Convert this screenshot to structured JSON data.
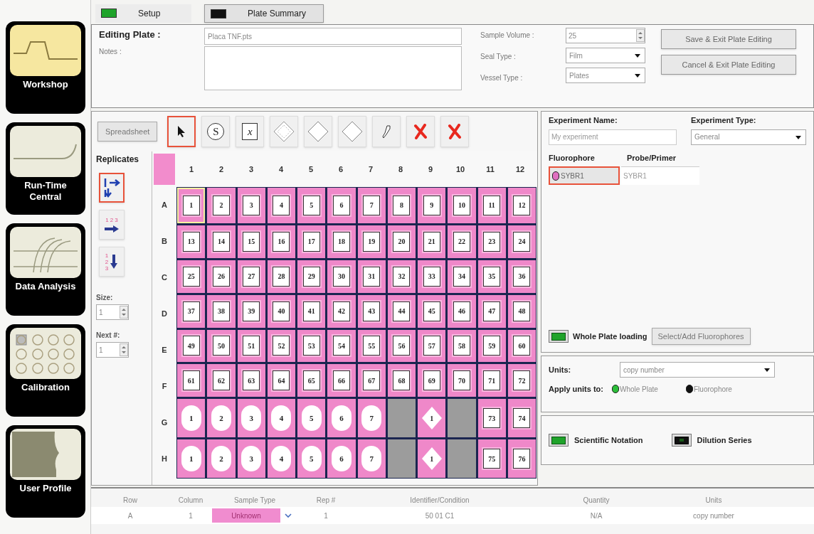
{
  "tabs": [
    {
      "label": "Setup",
      "selected": true,
      "on": true
    },
    {
      "label": "Plate Summary",
      "selected": false,
      "on": false
    }
  ],
  "nav": [
    {
      "label": "Workshop",
      "kind": "wave",
      "selected": true
    },
    {
      "label": "Run-Time Central",
      "kind": "curve",
      "selected": false
    },
    {
      "label": "Data Analysis",
      "kind": "curves",
      "selected": false
    },
    {
      "label": "Calibration",
      "kind": "wells",
      "selected": false
    },
    {
      "label": "User Profile",
      "kind": "user",
      "selected": false
    }
  ],
  "editing": {
    "title": "Editing Plate :",
    "file": "Placa TNF.pts",
    "notes_label": "Notes :",
    "sample_volume_label": "Sample Volume :",
    "sample_volume": "25",
    "seal_type_label": "Seal Type :",
    "seal_type": "Film",
    "vessel_type_label": "Vessel Type :",
    "vessel_type": "Plates",
    "buttons": [
      "Save & Exit Plate Editing",
      "Cancel & Exit Plate Editing"
    ]
  },
  "toolbar": {
    "spreadsheet": "Spreadsheet",
    "tools": [
      {
        "kind": "pointer",
        "selected": true
      },
      {
        "kind": "standard",
        "label": "S",
        "selected": false
      },
      {
        "kind": "unknown",
        "label": "x",
        "selected": false
      },
      {
        "kind": "ntc",
        "selected": false
      },
      {
        "kind": "diamond",
        "selected": false
      },
      {
        "kind": "diamond",
        "selected": false
      },
      {
        "kind": "pipette",
        "selected": false
      },
      {
        "kind": "clear",
        "selected": false
      },
      {
        "kind": "clear",
        "selected": false
      }
    ]
  },
  "replicates": {
    "title": "Replicates",
    "modes": [
      {
        "kind": "block",
        "selected": true
      },
      {
        "kind": "across",
        "digits": [
          "1",
          "2",
          "3"
        ],
        "selected": false
      },
      {
        "kind": "down",
        "digits": [
          "1",
          "2",
          "3"
        ],
        "selected": false
      }
    ],
    "size_label": "Size:",
    "size": "1",
    "next_label": "Next #:",
    "next": "1"
  },
  "plate": {
    "columns": [
      "1",
      "2",
      "3",
      "4",
      "5",
      "6",
      "7",
      "8",
      "9",
      "10",
      "11",
      "12"
    ],
    "rows": [
      {
        "label": "A",
        "wells": [
          {
            "kind": "unknown",
            "label": "1",
            "selected": true
          },
          {
            "kind": "unknown",
            "label": "2",
            "selected": false
          },
          {
            "kind": "unknown",
            "label": "3",
            "selected": false
          },
          {
            "kind": "unknown",
            "label": "4",
            "selected": false
          },
          {
            "kind": "unknown",
            "label": "5",
            "selected": false
          },
          {
            "kind": "unknown",
            "label": "6",
            "selected": false
          },
          {
            "kind": "unknown",
            "label": "7",
            "selected": false
          },
          {
            "kind": "unknown",
            "label": "8",
            "selected": false
          },
          {
            "kind": "unknown",
            "label": "9",
            "selected": false
          },
          {
            "kind": "unknown",
            "label": "10",
            "selected": false
          },
          {
            "kind": "unknown",
            "label": "11",
            "selected": false
          },
          {
            "kind": "unknown",
            "label": "12",
            "selected": false
          }
        ]
      },
      {
        "label": "B",
        "wells": [
          {
            "kind": "unknown",
            "label": "13",
            "selected": false
          },
          {
            "kind": "unknown",
            "label": "14",
            "selected": false
          },
          {
            "kind": "unknown",
            "label": "15",
            "selected": false
          },
          {
            "kind": "unknown",
            "label": "16",
            "selected": false
          },
          {
            "kind": "unknown",
            "label": "17",
            "selected": false
          },
          {
            "kind": "unknown",
            "label": "18",
            "selected": false
          },
          {
            "kind": "unknown",
            "label": "19",
            "selected": false
          },
          {
            "kind": "unknown",
            "label": "20",
            "selected": false
          },
          {
            "kind": "unknown",
            "label": "21",
            "selected": false
          },
          {
            "kind": "unknown",
            "label": "22",
            "selected": false
          },
          {
            "kind": "unknown",
            "label": "23",
            "selected": false
          },
          {
            "kind": "unknown",
            "label": "24",
            "selected": false
          }
        ]
      },
      {
        "label": "C",
        "wells": [
          {
            "kind": "unknown",
            "label": "25",
            "selected": false
          },
          {
            "kind": "unknown",
            "label": "26",
            "selected": false
          },
          {
            "kind": "unknown",
            "label": "27",
            "selected": false
          },
          {
            "kind": "unknown",
            "label": "28",
            "selected": false
          },
          {
            "kind": "unknown",
            "label": "29",
            "selected": false
          },
          {
            "kind": "unknown",
            "label": "30",
            "selected": false
          },
          {
            "kind": "unknown",
            "label": "31",
            "selected": false
          },
          {
            "kind": "unknown",
            "label": "32",
            "selected": false
          },
          {
            "kind": "unknown",
            "label": "33",
            "selected": false
          },
          {
            "kind": "unknown",
            "label": "34",
            "selected": false
          },
          {
            "kind": "unknown",
            "label": "35",
            "selected": false
          },
          {
            "kind": "unknown",
            "label": "36",
            "selected": false
          }
        ]
      },
      {
        "label": "D",
        "wells": [
          {
            "kind": "unknown",
            "label": "37",
            "selected": false
          },
          {
            "kind": "unknown",
            "label": "38",
            "selected": false
          },
          {
            "kind": "unknown",
            "label": "39",
            "selected": false
          },
          {
            "kind": "unknown",
            "label": "40",
            "selected": false
          },
          {
            "kind": "unknown",
            "label": "41",
            "selected": false
          },
          {
            "kind": "unknown",
            "label": "42",
            "selected": false
          },
          {
            "kind": "unknown",
            "label": "43",
            "selected": false
          },
          {
            "kind": "unknown",
            "label": "44",
            "selected": false
          },
          {
            "kind": "unknown",
            "label": "45",
            "selected": false
          },
          {
            "kind": "unknown",
            "label": "46",
            "selected": false
          },
          {
            "kind": "unknown",
            "label": "47",
            "selected": false
          },
          {
            "kind": "unknown",
            "label": "48",
            "selected": false
          }
        ]
      },
      {
        "label": "E",
        "wells": [
          {
            "kind": "unknown",
            "label": "49",
            "selected": false
          },
          {
            "kind": "unknown",
            "label": "50",
            "selected": false
          },
          {
            "kind": "unknown",
            "label": "51",
            "selected": false
          },
          {
            "kind": "unknown",
            "label": "52",
            "selected": false
          },
          {
            "kind": "unknown",
            "label": "53",
            "selected": false
          },
          {
            "kind": "unknown",
            "label": "54",
            "selected": false
          },
          {
            "kind": "unknown",
            "label": "55",
            "selected": false
          },
          {
            "kind": "unknown",
            "label": "56",
            "selected": false
          },
          {
            "kind": "unknown",
            "label": "57",
            "selected": false
          },
          {
            "kind": "unknown",
            "label": "58",
            "selected": false
          },
          {
            "kind": "unknown",
            "label": "59",
            "selected": false
          },
          {
            "kind": "unknown",
            "label": "60",
            "selected": false
          }
        ]
      },
      {
        "label": "F",
        "wells": [
          {
            "kind": "unknown",
            "label": "61",
            "selected": false
          },
          {
            "kind": "unknown",
            "label": "62",
            "selected": false
          },
          {
            "kind": "unknown",
            "label": "63",
            "selected": false
          },
          {
            "kind": "unknown",
            "label": "64",
            "selected": false
          },
          {
            "kind": "unknown",
            "label": "65",
            "selected": false
          },
          {
            "kind": "unknown",
            "label": "66",
            "selected": false
          },
          {
            "kind": "unknown",
            "label": "67",
            "selected": false
          },
          {
            "kind": "unknown",
            "label": "68",
            "selected": false
          },
          {
            "kind": "unknown",
            "label": "69",
            "selected": false
          },
          {
            "kind": "unknown",
            "label": "70",
            "selected": false
          },
          {
            "kind": "unknown",
            "label": "71",
            "selected": false
          },
          {
            "kind": "unknown",
            "label": "72",
            "selected": false
          }
        ]
      },
      {
        "label": "G",
        "wells": [
          {
            "kind": "standard",
            "label": "1",
            "selected": false
          },
          {
            "kind": "standard",
            "label": "2",
            "selected": false
          },
          {
            "kind": "standard",
            "label": "3",
            "selected": false
          },
          {
            "kind": "standard",
            "label": "4",
            "selected": false
          },
          {
            "kind": "standard",
            "label": "5",
            "selected": false
          },
          {
            "kind": "standard",
            "label": "6",
            "selected": false
          },
          {
            "kind": "standard",
            "label": "7",
            "selected": false
          },
          {
            "kind": "empty",
            "selected": false
          },
          {
            "kind": "ntc",
            "label": "1",
            "selected": false
          },
          {
            "kind": "empty",
            "selected": false
          },
          {
            "kind": "unknown",
            "label": "73",
            "selected": false
          },
          {
            "kind": "unknown",
            "label": "74",
            "selected": false
          }
        ]
      },
      {
        "label": "H",
        "wells": [
          {
            "kind": "standard",
            "label": "1",
            "selected": false
          },
          {
            "kind": "standard",
            "label": "2",
            "selected": false
          },
          {
            "kind": "standard",
            "label": "3",
            "selected": false
          },
          {
            "kind": "standard",
            "label": "4",
            "selected": false
          },
          {
            "kind": "standard",
            "label": "5",
            "selected": false
          },
          {
            "kind": "standard",
            "label": "6",
            "selected": false
          },
          {
            "kind": "standard",
            "label": "7",
            "selected": false
          },
          {
            "kind": "empty",
            "selected": false
          },
          {
            "kind": "ntc",
            "label": "1",
            "selected": false
          },
          {
            "kind": "empty",
            "selected": false
          },
          {
            "kind": "unknown",
            "label": "75",
            "selected": false
          },
          {
            "kind": "unknown",
            "label": "76",
            "selected": false
          }
        ]
      }
    ]
  },
  "experiment": {
    "name_label": "Experiment Name:",
    "name": "My experiment",
    "type_label": "Experiment Type:",
    "type": "General",
    "fluor_columns": [
      "Fluorophore",
      "Probe/Primer"
    ],
    "fluorophores": [
      {
        "name": "SYBR1",
        "probe": "SYBR1",
        "color": "#e070c0",
        "selected": true
      }
    ],
    "whole_plate": {
      "label": "Whole Plate loading",
      "on": true
    },
    "select_button": "Select/Add Fluorophores"
  },
  "units": {
    "label": "Units:",
    "value": "copy number",
    "apply_label": "Apply units to:",
    "options": [
      {
        "label": "Whole Plate",
        "selected": true
      },
      {
        "label": "Fluorophore",
        "selected": false
      }
    ]
  },
  "notation": [
    {
      "label": "Scientific Notation",
      "on": true
    },
    {
      "label": "Dilution Series",
      "on": false
    }
  ],
  "table": {
    "columns": [
      "Row",
      "Column",
      "Sample Type",
      "Rep #",
      "Identifier/Condition",
      "Quantity",
      "Units"
    ],
    "rows": [
      [
        "A",
        "1",
        "Unknown",
        "1",
        "50 01 C1",
        "N/A",
        "copy number"
      ]
    ]
  }
}
